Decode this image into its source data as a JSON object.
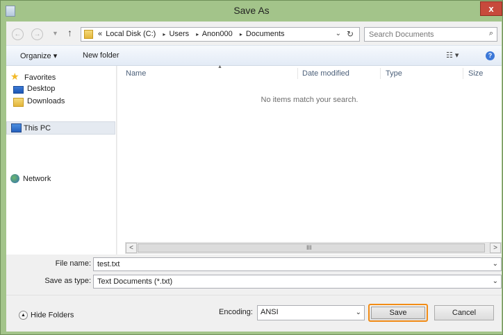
{
  "window": {
    "title": "Save As",
    "close_glyph": "x"
  },
  "address_bar": {
    "back_glyph": "←",
    "forward_glyph": "→",
    "up_glyph": "↑",
    "prefix": "«",
    "crumbs": [
      "Local Disk (C:)",
      "Users",
      "Anon000",
      "Documents"
    ],
    "separator": "▸",
    "dropdown_glyph": "⌄",
    "refresh_glyph": "↻",
    "search_placeholder": "Search Documents",
    "search_glyph": "⌕"
  },
  "toolbar": {
    "organize_label": "Organize ▾",
    "new_folder_label": "New folder",
    "view_glyph": "☷ ▾",
    "help_glyph": "?"
  },
  "nav_pane": {
    "favorites": "Favorites",
    "desktop": "Desktop",
    "downloads": "Downloads",
    "this_pc": "This PC",
    "network": "Network"
  },
  "file_list": {
    "columns": [
      "Name",
      "Date modified",
      "Type",
      "Size"
    ],
    "empty_message": "No items match your search.",
    "scroll_left": "<",
    "scroll_right": ">",
    "scroll_grip": "III"
  },
  "form": {
    "file_name_label": "File name:",
    "file_name_value": "test.txt",
    "save_type_label": "Save as type:",
    "save_type_value": "Text Documents (*.txt)",
    "combo_glyph": "⌄"
  },
  "footer": {
    "hide_folders_label": "Hide Folders",
    "hide_glyph": "▲",
    "encoding_label": "Encoding:",
    "encoding_value": "ANSI",
    "save_label": "Save",
    "cancel_label": "Cancel"
  },
  "colors": {
    "frame": "#a3c48a",
    "close_button": "#c74a3c",
    "save_focus": "#f28c16"
  }
}
